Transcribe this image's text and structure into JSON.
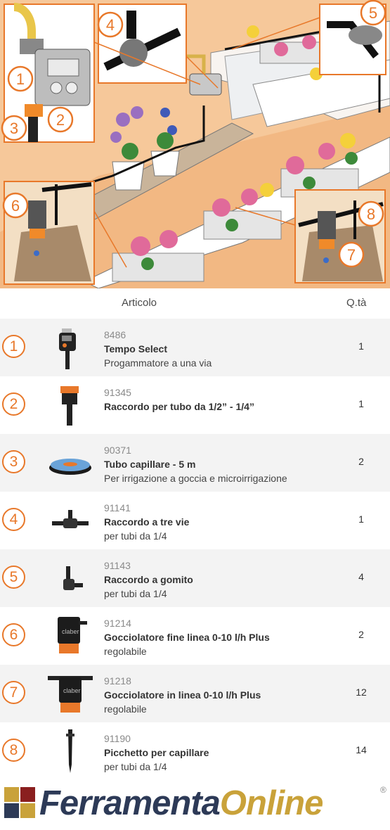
{
  "illustration": {
    "callouts": [
      "1",
      "2",
      "3",
      "4",
      "5",
      "6",
      "7",
      "8"
    ]
  },
  "table": {
    "header": {
      "article": "Articolo",
      "qty": "Q.tà"
    },
    "rows": [
      {
        "num": "1",
        "code": "8486",
        "name": "Tempo Select",
        "desc": "Progammatore a una via",
        "qty": "1",
        "icon": "timer-icon"
      },
      {
        "num": "2",
        "code": "91345",
        "name": "Raccordo per tubo da 1/2” - 1/4”",
        "desc": "",
        "qty": "1",
        "icon": "adapter-icon"
      },
      {
        "num": "3",
        "code": "90371",
        "name": "Tubo capillare - 5 m",
        "desc": "Per irrigazione a goccia e microirrigazione",
        "qty": "2",
        "icon": "hose-coil-icon"
      },
      {
        "num": "4",
        "code": "91141",
        "name": "Raccordo a tre vie",
        "desc": "per tubi da 1/4",
        "qty": "1",
        "icon": "tee-connector-icon"
      },
      {
        "num": "5",
        "code": "91143",
        "name": "Raccordo a gomito",
        "desc": "per tubi da 1/4",
        "qty": "4",
        "icon": "elbow-connector-icon"
      },
      {
        "num": "6",
        "code": "91214",
        "name": "Gocciolatore fine linea 0-10 l/h Plus",
        "desc": "regolabile",
        "qty": "2",
        "icon": "end-dripper-icon"
      },
      {
        "num": "7",
        "code": "91218",
        "name": "Gocciolatore in linea 0-10 l/h Plus",
        "desc": "regolabile",
        "qty": "12",
        "icon": "inline-dripper-icon"
      },
      {
        "num": "8",
        "code": "91190",
        "name": "Picchetto per capillare",
        "desc": "per tubi da 1/4",
        "qty": "14",
        "icon": "stake-icon"
      }
    ]
  },
  "footer": {
    "logo_part1": "Ferramenta",
    "logo_part2": "Online",
    "registered": "®",
    "colors": {
      "brand_navy": "#2d3a57",
      "brand_gold": "#c9a23a",
      "accent_orange": "#e8782a"
    }
  }
}
